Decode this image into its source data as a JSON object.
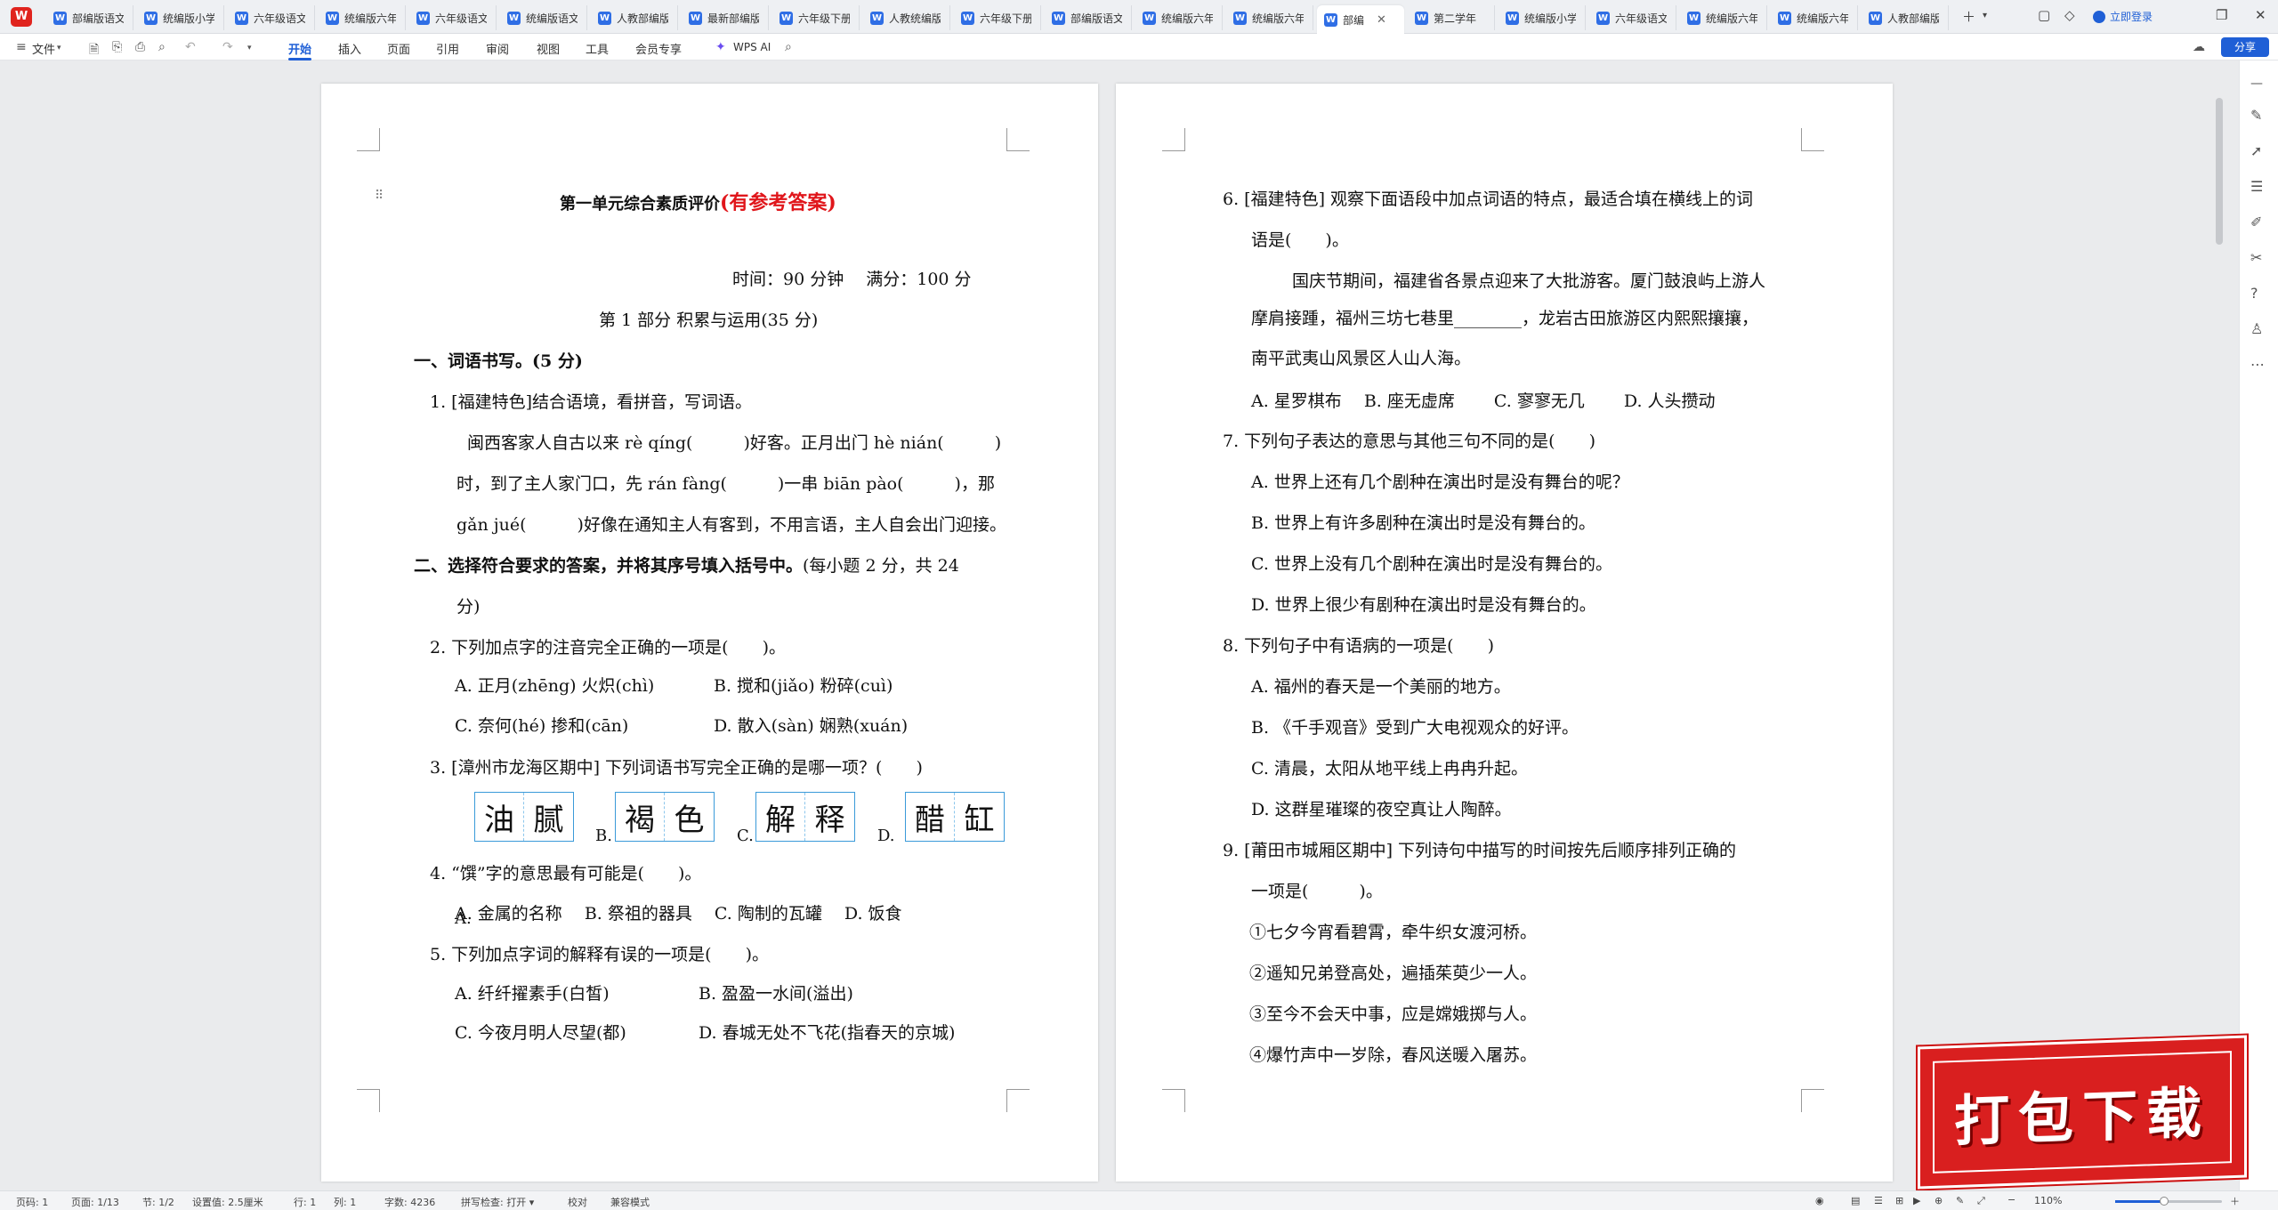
{
  "tabs": [
    {
      "label": "部编版语文"
    },
    {
      "label": "统编版小学"
    },
    {
      "label": "六年级语文"
    },
    {
      "label": "统编版六年"
    },
    {
      "label": "六年级语文"
    },
    {
      "label": "统编版语文"
    },
    {
      "label": "人教部编版"
    },
    {
      "label": "最新部编版"
    },
    {
      "label": "六年级下册"
    },
    {
      "label": "人教统编版"
    },
    {
      "label": "六年级下册"
    },
    {
      "label": "部编版语文"
    },
    {
      "label": "统编版六年"
    },
    {
      "label": "统编版六年"
    },
    {
      "label": "部编"
    },
    {
      "label": "第二学年"
    },
    {
      "label": "统编版小学"
    },
    {
      "label": "六年级语文"
    },
    {
      "label": "统编版六年"
    },
    {
      "label": "统编版六年"
    },
    {
      "label": "人教部编版"
    }
  ],
  "login_label": "立即登录",
  "file_menu": "文件",
  "ribbon_tabs": [
    "开始",
    "插入",
    "页面",
    "引用",
    "审阅",
    "视图",
    "工具",
    "会员专享"
  ],
  "wps_ai": "WPS AI",
  "share_label": "分享",
  "left_page": {
    "title": "第一单元综合素质评价",
    "title_red": "(有参考答案)",
    "time_line": "时间：90 分钟　 满分：100 分",
    "part1": "第 1 部分  积累与运用(35 分)",
    "s1_head": "一、词语书写。(5 分)",
    "q1": "1.  [福建特色]结合语境，看拼音，写词语。",
    "q1_l1": "闽西客家人自古以来  rè qíng(　　　)好客。正月出门  hè nián(　　　)",
    "q1_l2": "时，到了主人家门口，先  rán fàng(　　　)一串  biān pào(　　　)，那",
    "q1_l3": "gǎn jué(　　　)好像在通知主人有客到，不用言语，主人自会出门迎接。",
    "s2_head": "二、选择符合要求的答案，并将其序号填入括号中。",
    "s2_tail": "(每小题 2 分，共 24",
    "s2_tail2": "分)",
    "q2": "2.  下列加点字的注音完全正确的一项是(　　)。",
    "q2_a": "A.  正月(zhēng)  火炽(chì)",
    "q2_b": "B.  搅和(jiǎo)  粉碎(cuì)",
    "q2_c": "C.  奈何(hé)  掺和(cān)",
    "q2_d": "D.  散入(sàn)  娴熟(xuán)",
    "q3": "3. [漳州市龙海区期中]  下列词语书写完全正确的是哪一项？(　　)",
    "q3_opts": [
      {
        "letter": "A.",
        "chars": [
          "油",
          "腻"
        ]
      },
      {
        "letter": "B.",
        "chars": [
          "褐",
          "色"
        ]
      },
      {
        "letter": "C.",
        "chars": [
          "解",
          "释"
        ]
      },
      {
        "letter": "D.",
        "chars": [
          "醋",
          "缸"
        ]
      }
    ],
    "q4": "4. “馔”字的意思最有可能是(　　)。",
    "q4_opts": "A.  金属的名称　  B.  祭祖的器具　  C.  陶制的瓦罐　  D.  饭食",
    "q5": "5.  下列加点字词的解释有误的一项是(　　)。",
    "q5_a": "A.  纤纤擢素手(白皙)",
    "q5_b": "B.  盈盈一水间(溢出)",
    "q5_c": "C.  今夜月明人尽望(都)",
    "q5_d": "D.  春城无处不飞花(指春天的京城)"
  },
  "right_page": {
    "q6_l1": "6.  [福建特色]  观察下面语段中加点词语的特点，最适合填在横线上的词",
    "q6_l2": "语是(　　)。",
    "q6_p1": "国庆节期间，福建省各景点迎来了大批游客。厦门鼓浪屿上游人",
    "q6_p2": "摩肩接踵，福州三坊七巷里________，龙岩古田旅游区内熙熙攘攘，",
    "q6_p3": "南平武夷山风景区人山人海。",
    "q6_opts": "A.  星罗棋布　  B.  座无虚席　　  C.  寥寥无几　　  D.  人头攒动",
    "q7": "7.  下列句子表达的意思与其他三句不同的是(　　)",
    "q7_a": "A.  世界上还有几个剧种在演出时是没有舞台的呢？",
    "q7_b": "B.  世界上有许多剧种在演出时是没有舞台的。",
    "q7_c": "C.  世界上没有几个剧种在演出时是没有舞台的。",
    "q7_d": "D.  世界上很少有剧种在演出时是没有舞台的。",
    "q8": "8.  下列句子中有语病的一项是(　　)",
    "q8_a": "A.  福州的春天是一个美丽的地方。",
    "q8_b": "B.  《千手观音》受到广大电视观众的好评。",
    "q8_c": "C.  清晨，太阳从地平线上冉冉升起。",
    "q8_d": "D.  这群星璀璨的夜空真让人陶醉。",
    "q9_l1": "9.  [莆田市城厢区期中]  下列诗句中描写的时间按先后顺序排列正确的",
    "q9_l2": "一项是(　　　)。",
    "q9_1": "①七夕今宵看碧霄，牵牛织女渡河桥。",
    "q9_2": "②遥知兄弟登高处，遍插茱萸少一人。",
    "q9_3": "③至今不会天中事，应是嫦娥掷与人。",
    "q9_4": "④爆竹声中一岁除，春风送暖入屠苏。"
  },
  "promo_text": "打包下载",
  "status": {
    "page_num": "页码: 1",
    "pages": "页面: 1/13",
    "section": "节: 1/2",
    "setting": "设置值: 2.5厘米",
    "row": "行: 1",
    "col": "列: 1",
    "words": "字数: 4236",
    "spell": "拼写检查: 打开 ▾",
    "proof": "校对",
    "compat": "兼容模式",
    "zoom": "110%",
    "zoom_level": 0.46
  }
}
